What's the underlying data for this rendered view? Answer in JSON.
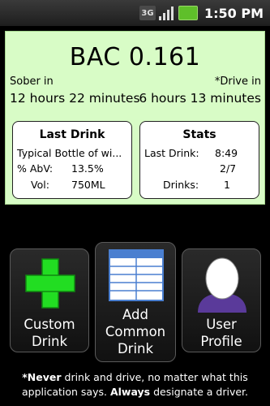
{
  "status_bar": {
    "network_type": "3G",
    "signal_icon": "signal-bars-icon",
    "battery_icon": "battery-charging-icon",
    "time": "1:50 PM"
  },
  "bac": {
    "text": "BAC 0.161"
  },
  "sober": {
    "label": "Sober in",
    "time": "12 hours 22 minutes"
  },
  "drive": {
    "label": "*Drive in",
    "time": "6 hours 13 minutes"
  },
  "last_drink": {
    "title": "Last Drink",
    "name": "Typical Bottle of wi...",
    "abv_label": "% AbV:",
    "abv_value": "13.5%",
    "vol_label": "Vol:",
    "vol_value": "750ML"
  },
  "stats": {
    "title": "Stats",
    "last_drink_label": "Last Drink:",
    "last_drink_time": "8:49",
    "last_drink_date": "2/7",
    "drinks_label": "Drinks:",
    "drinks_value": "1"
  },
  "buttons": {
    "custom_line1": "Custom",
    "custom_line2": "Drink",
    "add_line1": "Add",
    "add_line2": "Common",
    "add_line3": "Drink",
    "user_line1": "User",
    "user_line2": "Profile"
  },
  "footer": {
    "star": "*",
    "never": "Never",
    "mid": " drink and drive, no matter what this",
    "line2_start": "application says. ",
    "always": "Always",
    "line2_end": " designate a driver."
  },
  "colors": {
    "panel_bg": "#d8fcc6",
    "plus_green": "#22dd22",
    "profile_purple": "#5a3a9a",
    "table_blue": "#4a7fd0"
  }
}
